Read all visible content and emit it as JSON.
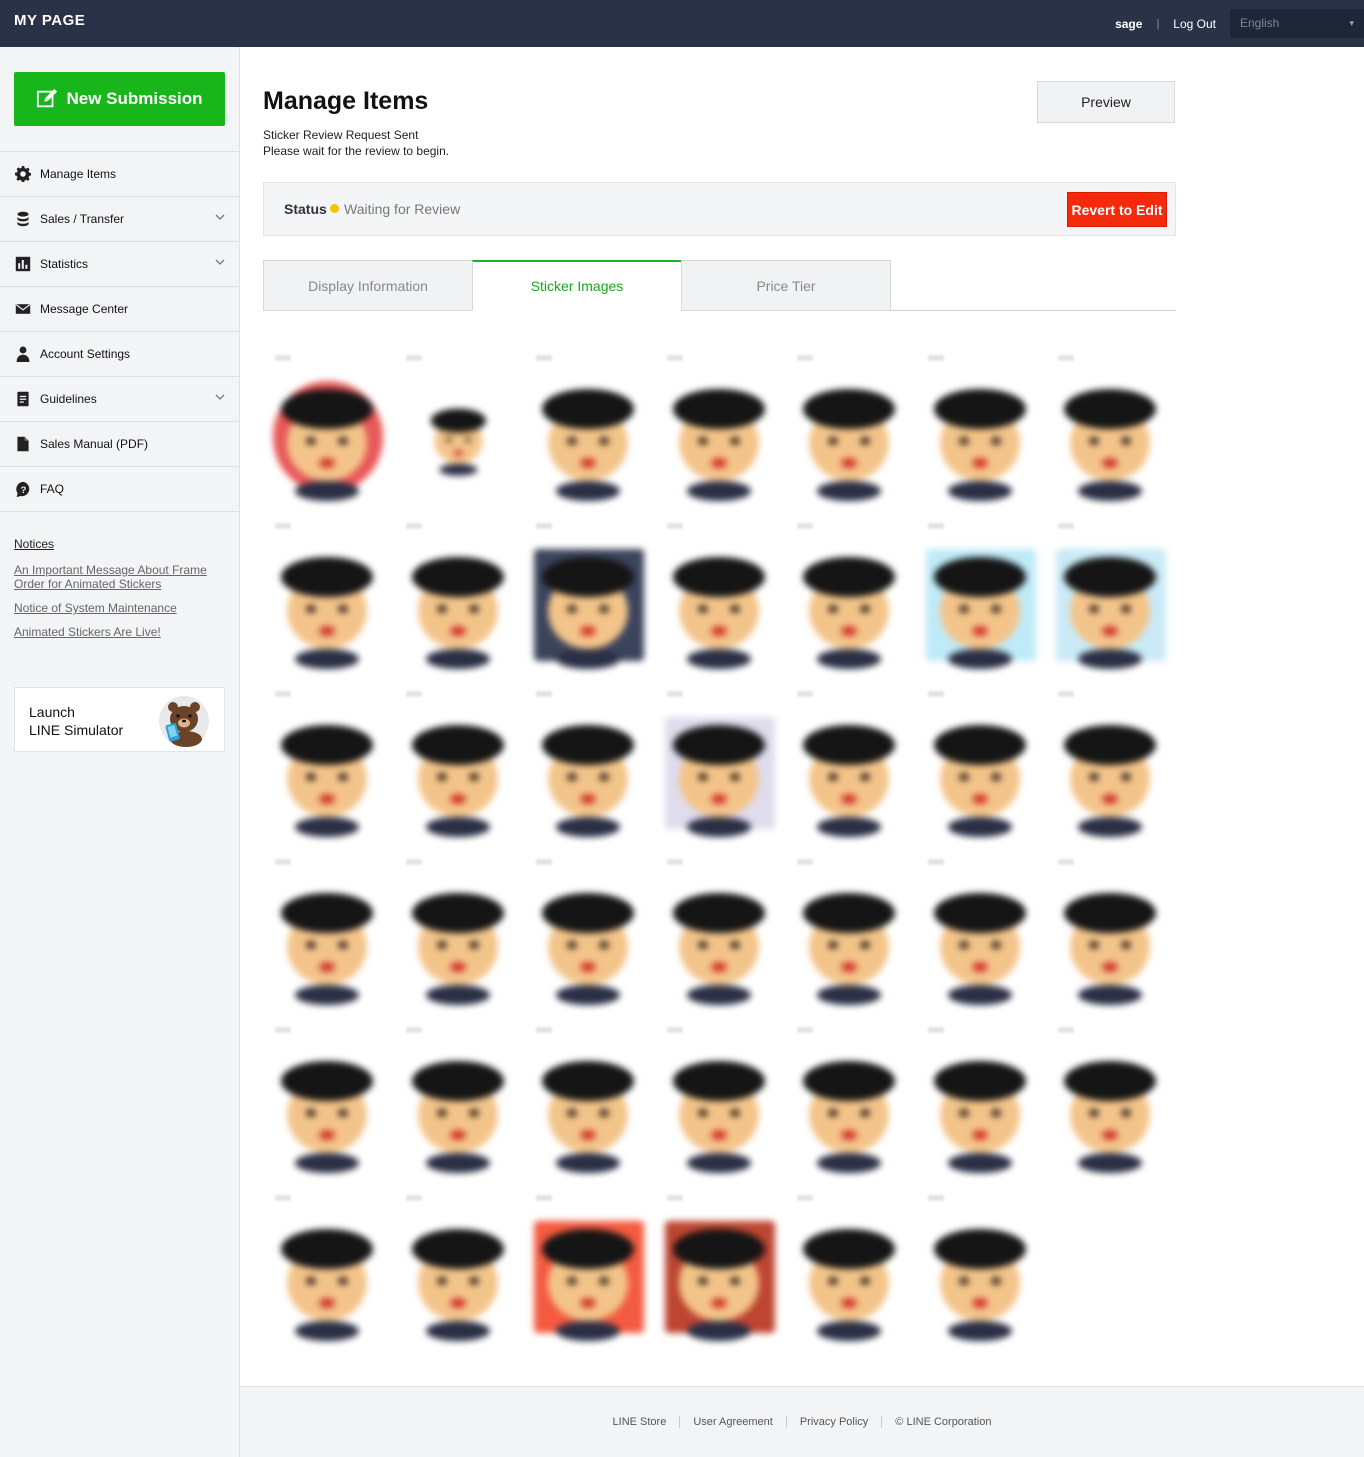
{
  "header": {
    "brand": "MY PAGE",
    "username": "sage",
    "separator": "|",
    "logout_label": "Log Out",
    "language": "English"
  },
  "sidebar": {
    "new_submission_label": "New Submission",
    "items": [
      {
        "label": "Manage Items",
        "icon": "gear-icon",
        "has_chevron": false
      },
      {
        "label": "Sales / Transfer",
        "icon": "coins-icon",
        "has_chevron": true
      },
      {
        "label": "Statistics",
        "icon": "bar-chart-icon",
        "has_chevron": true
      },
      {
        "label": "Message Center",
        "icon": "envelope-icon",
        "has_chevron": false
      },
      {
        "label": "Account Settings",
        "icon": "user-icon",
        "has_chevron": false
      },
      {
        "label": "Guidelines",
        "icon": "document-icon",
        "has_chevron": true
      },
      {
        "label": "Sales Manual (PDF)",
        "icon": "file-icon",
        "has_chevron": false
      },
      {
        "label": "FAQ",
        "icon": "question-icon",
        "has_chevron": false
      }
    ],
    "notices": {
      "title": "Notices",
      "links": [
        "An Important Message About Frame Order for Animated Stickers",
        "Notice of System Maintenance",
        "Animated Stickers Are Live!"
      ]
    },
    "simulator": {
      "line1": "Launch",
      "line2": "LINE Simulator"
    }
  },
  "main": {
    "title": "Manage Items",
    "subtitle_line1": "Sticker Review Request Sent",
    "subtitle_line2": "Please wait for the review to begin.",
    "preview_label": "Preview",
    "status": {
      "label": "Status",
      "value": "Waiting for Review",
      "dot_color": "#f2c500",
      "revert_label": "Revert to Edit"
    },
    "tabs": [
      {
        "label": "Display Information",
        "active": false
      },
      {
        "label": "Sticker Images",
        "active": true
      },
      {
        "label": "Price Tier",
        "active": false
      }
    ],
    "sticker_grid": {
      "columns": 7,
      "rows": 6,
      "count": 41,
      "blurred": true
    }
  },
  "footer": {
    "links": [
      "LINE Store",
      "User Agreement",
      "Privacy Policy",
      "© LINE Corporation"
    ]
  },
  "colors": {
    "topbar": "#2a3247",
    "accent_green": "#18b51b",
    "revert_red": "#f52a0c"
  }
}
